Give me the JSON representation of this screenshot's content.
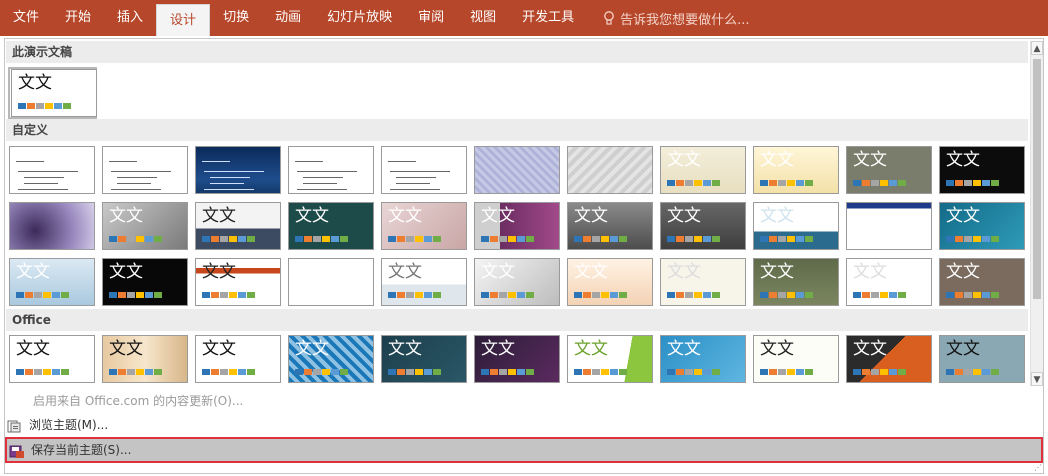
{
  "ribbon": {
    "tabs": [
      "文件",
      "开始",
      "插入",
      "设计",
      "切换",
      "动画",
      "幻灯片放映",
      "审阅",
      "视图",
      "开发工具"
    ],
    "active": 3,
    "tell_me": "告诉我您想要做什么..."
  },
  "sections": {
    "this_presentation": "此演示文稿",
    "custom": "自定义",
    "office": "Office"
  },
  "theme_sample_text": "文文",
  "footer": {
    "update": "启用来自 Office.com 的内容更新(O)...",
    "browse": "浏览主题(M)...",
    "save": "保存当前主题(S)..."
  },
  "colors": {
    "ribbon": "#b7472a",
    "highlight_border": "#e0303a",
    "selected_bg": "#c4c4c4"
  }
}
